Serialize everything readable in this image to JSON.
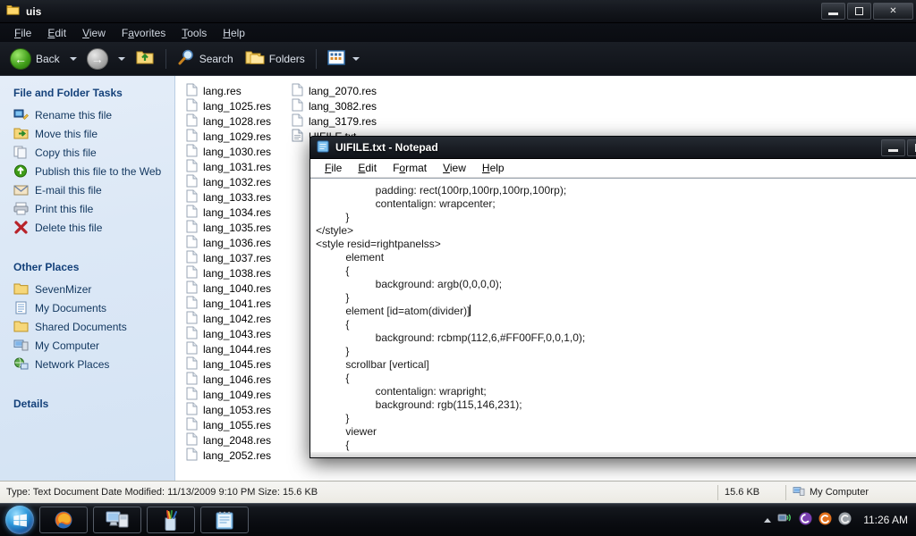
{
  "explorer": {
    "title": "uis",
    "title_icon": "folder-icon",
    "window_buttons": {
      "minimize": "minimize-icon",
      "restore": "restore-icon",
      "close": "close-icon"
    },
    "menu": [
      {
        "label": "File",
        "accel": "F"
      },
      {
        "label": "Edit",
        "accel": "E"
      },
      {
        "label": "View",
        "accel": "V"
      },
      {
        "label": "Favorites",
        "accel": "a"
      },
      {
        "label": "Tools",
        "accel": "T"
      },
      {
        "label": "Help",
        "accel": "H"
      }
    ],
    "toolbar": {
      "back_label": "Back",
      "back_icon": "back-arrow-icon",
      "forward_icon": "forward-arrow-icon",
      "up_icon": "up-folder-icon",
      "search_label": "Search",
      "search_icon": "magnifier-icon",
      "folders_label": "Folders",
      "folders_icon": "folders-icon",
      "views_icon": "views-icon"
    },
    "sidebar": {
      "panes": [
        {
          "header": "File and Folder Tasks",
          "collapsible": true,
          "items": [
            {
              "label": "Rename this file",
              "icon": "rename-icon"
            },
            {
              "label": "Move this file",
              "icon": "move-file-icon"
            },
            {
              "label": "Copy this file",
              "icon": "copy-file-icon"
            },
            {
              "label": "Publish this file to the Web",
              "icon": "publish-web-icon"
            },
            {
              "label": "E-mail this file",
              "icon": "email-icon"
            },
            {
              "label": "Print this file",
              "icon": "printer-icon"
            },
            {
              "label": "Delete this file",
              "icon": "delete-x-icon"
            }
          ]
        },
        {
          "header": "Other Places",
          "collapsible": true,
          "items": [
            {
              "label": "SevenMizer",
              "icon": "folder-icon"
            },
            {
              "label": "My Documents",
              "icon": "my-documents-icon"
            },
            {
              "label": "Shared Documents",
              "icon": "folder-icon"
            },
            {
              "label": "My Computer",
              "icon": "my-computer-icon"
            },
            {
              "label": "Network Places",
              "icon": "network-places-icon"
            }
          ]
        },
        {
          "header": "Details",
          "collapsible": true,
          "items": []
        }
      ]
    },
    "files": [
      {
        "name": "lang.res",
        "icon": "res-file-icon"
      },
      {
        "name": "lang_1025.res",
        "icon": "res-file-icon"
      },
      {
        "name": "lang_1028.res",
        "icon": "res-file-icon"
      },
      {
        "name": "lang_1029.res",
        "icon": "res-file-icon"
      },
      {
        "name": "lang_1030.res",
        "icon": "res-file-icon"
      },
      {
        "name": "lang_1031.res",
        "icon": "res-file-icon"
      },
      {
        "name": "lang_1032.res",
        "icon": "res-file-icon"
      },
      {
        "name": "lang_1033.res",
        "icon": "res-file-icon"
      },
      {
        "name": "lang_1034.res",
        "icon": "res-file-icon"
      },
      {
        "name": "lang_1035.res",
        "icon": "res-file-icon"
      },
      {
        "name": "lang_1036.res",
        "icon": "res-file-icon"
      },
      {
        "name": "lang_1037.res",
        "icon": "res-file-icon"
      },
      {
        "name": "lang_1038.res",
        "icon": "res-file-icon"
      },
      {
        "name": "lang_1040.res",
        "icon": "res-file-icon"
      },
      {
        "name": "lang_1041.res",
        "icon": "res-file-icon"
      },
      {
        "name": "lang_1042.res",
        "icon": "res-file-icon"
      },
      {
        "name": "lang_1043.res",
        "icon": "res-file-icon"
      },
      {
        "name": "lang_1044.res",
        "icon": "res-file-icon"
      },
      {
        "name": "lang_1045.res",
        "icon": "res-file-icon"
      },
      {
        "name": "lang_1046.res",
        "icon": "res-file-icon"
      },
      {
        "name": "lang_1049.res",
        "icon": "res-file-icon"
      },
      {
        "name": "lang_1053.res",
        "icon": "res-file-icon"
      },
      {
        "name": "lang_1055.res",
        "icon": "res-file-icon"
      },
      {
        "name": "lang_2048.res",
        "icon": "res-file-icon"
      },
      {
        "name": "lang_2052.res",
        "icon": "res-file-icon"
      },
      {
        "name": "lang_2070.res",
        "icon": "res-file-icon"
      },
      {
        "name": "lang_3082.res",
        "icon": "res-file-icon"
      },
      {
        "name": "lang_3179.res",
        "icon": "res-file-icon"
      },
      {
        "name": "UIFILE.txt",
        "icon": "text-file-icon"
      }
    ],
    "statusbar": {
      "details": "Type: Text Document Date Modified: 11/13/2009 9:10 PM Size: 15.6 KB",
      "size": "15.6 KB",
      "location": "My Computer",
      "location_icon": "my-computer-icon"
    }
  },
  "notepad": {
    "title": "UIFILE.txt - Notepad",
    "title_icon": "notepad-icon",
    "window_buttons": {
      "minimize": "minimize-icon",
      "restore": "restore-icon"
    },
    "menu": [
      {
        "label": "File",
        "accel": "F"
      },
      {
        "label": "Edit",
        "accel": "E"
      },
      {
        "label": "Format",
        "accel": "o"
      },
      {
        "label": "View",
        "accel": "V"
      },
      {
        "label": "Help",
        "accel": "H"
      }
    ],
    "content_before_caret": "                    padding: rect(100rp,100rp,100rp,100rp);\n                    contentalign: wrapcenter;\n          }\n</style>\n<style resid=rightpanelss>\n          element\n          {\n                    background: argb(0,0,0,0);\n          }\n          element [id=atom(divider)]",
    "content_after_caret": "\n          {\n                    background: rcbmp(112,6,#FF00FF,0,0,1,0);\n          }\n          scrollbar [vertical]\n          {\n                    contentalign: wrapright;\n                    background: rgb(115,146,231);\n          }\n          viewer\n          {"
  },
  "taskbar": {
    "start_icon": "windows-start-orb",
    "buttons": [
      {
        "name": "firefox",
        "icon": "firefox-icon"
      },
      {
        "name": "my-computer",
        "icon": "my-computer-icon"
      },
      {
        "name": "paint",
        "icon": "paint-icon"
      },
      {
        "name": "notepad",
        "icon": "notepad-icon"
      }
    ],
    "tray": {
      "overflow_icon": "show-hidden-icons-arrow",
      "network_icon": "network-icon",
      "icons": [
        "purple-circle-icon",
        "orange-circle-icon",
        "grey-circle-icon"
      ],
      "clock": "11:26 AM"
    }
  },
  "colors": {
    "sidebar_bg": "#dce8f6",
    "sidebar_header": "#14417a",
    "taskbar_bg": "#0b0d12",
    "accent_green": "#3f9c18"
  }
}
